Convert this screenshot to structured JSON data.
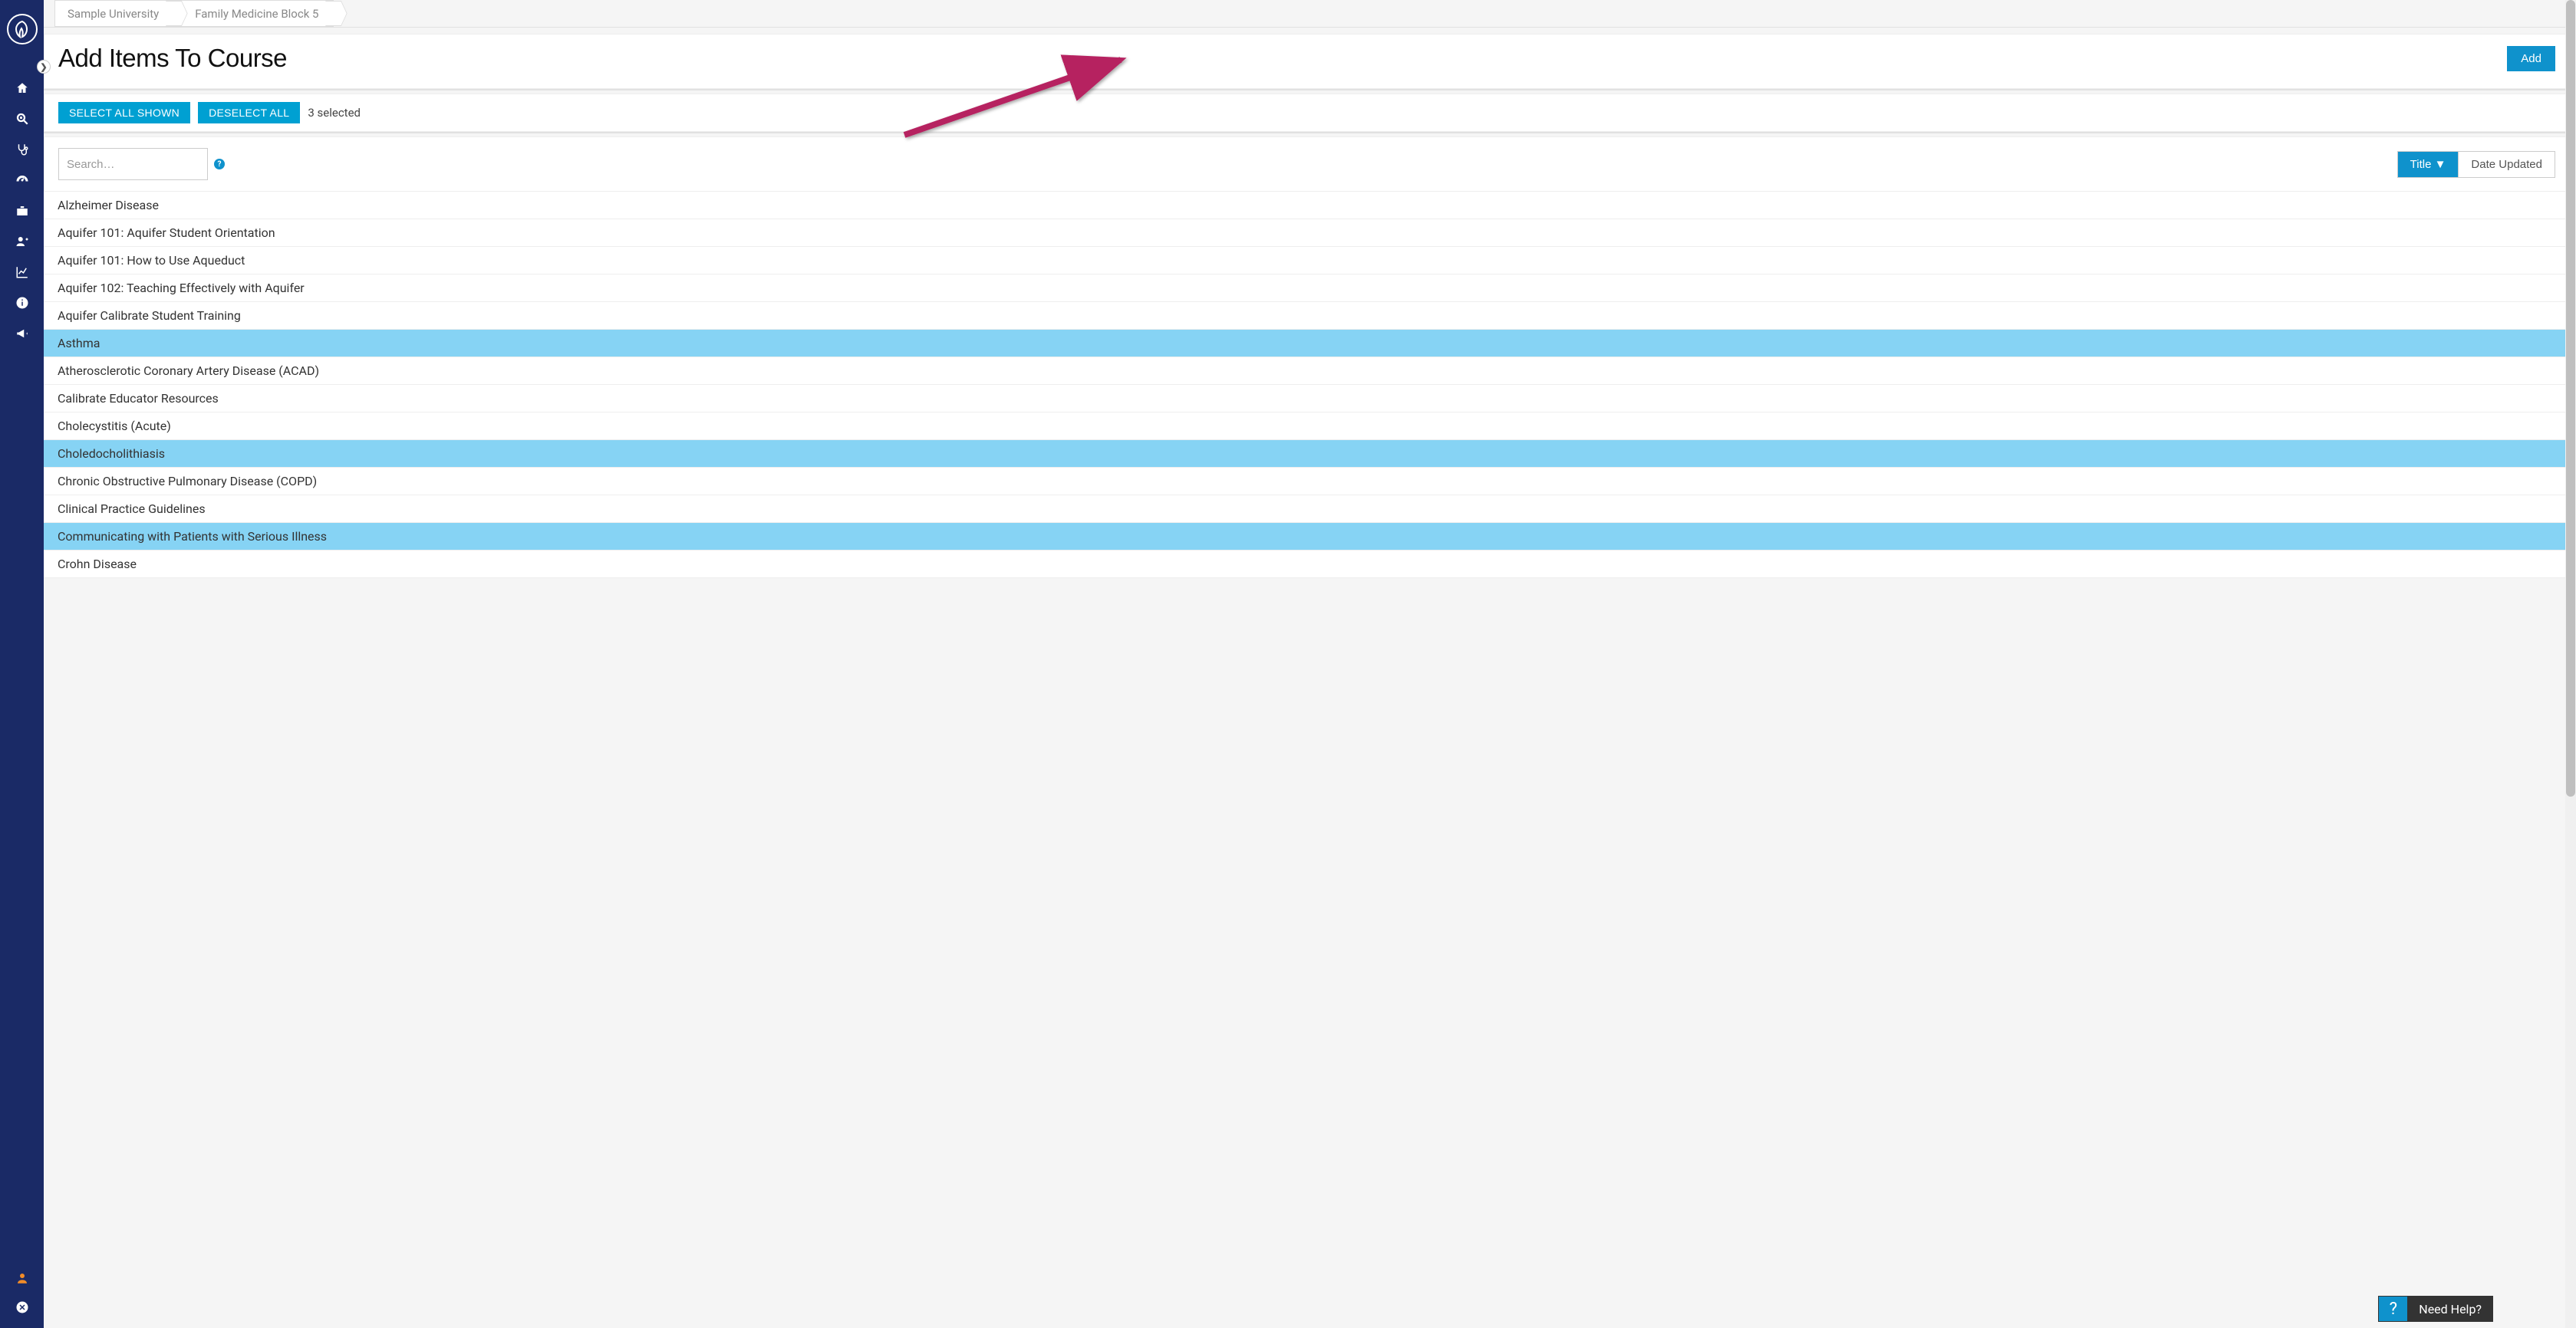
{
  "breadcrumb": {
    "items": [
      "Sample University",
      "Family Medicine Block 5"
    ]
  },
  "header": {
    "title": "Add Items To Course",
    "add_label": "Add"
  },
  "selection": {
    "select_all_label": "SELECT ALL SHOWN",
    "deselect_all_label": "DESELECT ALL",
    "count_text": "3 selected"
  },
  "search": {
    "placeholder": "Search…",
    "help_glyph": "?"
  },
  "sort": {
    "options": [
      "Title ▼",
      "Date Updated"
    ],
    "active_index": 0
  },
  "items": [
    {
      "title": "Alzheimer Disease",
      "selected": false
    },
    {
      "title": "Aquifer 101: Aquifer Student Orientation",
      "selected": false
    },
    {
      "title": "Aquifer 101: How to Use Aqueduct",
      "selected": false
    },
    {
      "title": "Aquifer 102: Teaching Effectively with Aquifer",
      "selected": false
    },
    {
      "title": "Aquifer Calibrate Student Training",
      "selected": false
    },
    {
      "title": "Asthma",
      "selected": true
    },
    {
      "title": "Atherosclerotic Coronary Artery Disease (ACAD)",
      "selected": false
    },
    {
      "title": "Calibrate Educator Resources",
      "selected": false
    },
    {
      "title": "Cholecystitis (Acute)",
      "selected": false
    },
    {
      "title": "Choledocholithiasis",
      "selected": true
    },
    {
      "title": "Chronic Obstructive Pulmonary Disease (COPD)",
      "selected": false
    },
    {
      "title": "Clinical Practice Guidelines",
      "selected": false
    },
    {
      "title": "Communicating with Patients with Serious Illness",
      "selected": true
    },
    {
      "title": "Crohn Disease",
      "selected": false
    }
  ],
  "help_widget": {
    "glyph": "?",
    "label": "Need Help?"
  },
  "sidebar": {
    "expand_glyph": "❯",
    "icons": [
      "home-icon",
      "search-icon",
      "stethoscope-icon",
      "gauge-icon",
      "briefcase-icon",
      "user-plus-icon",
      "line-chart-icon",
      "info-icon",
      "bullhorn-icon"
    ],
    "bottom_icons": [
      "user-icon",
      "close-circle-icon"
    ]
  }
}
